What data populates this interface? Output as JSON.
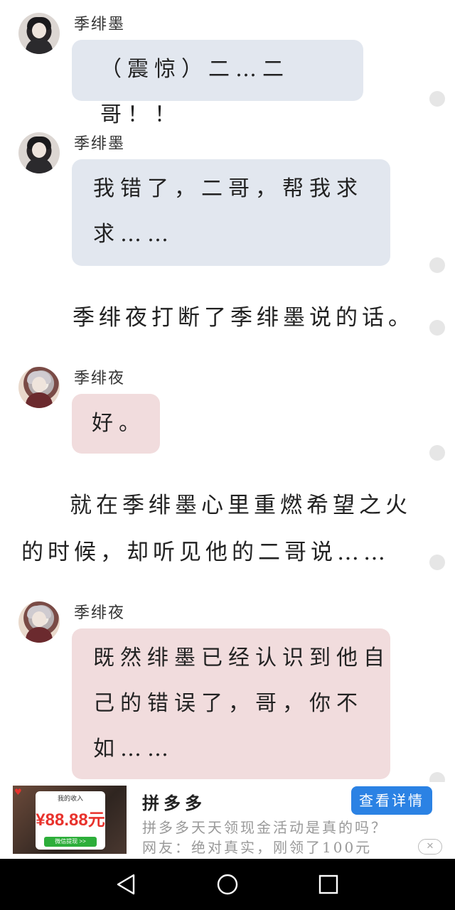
{
  "messages": [
    {
      "speaker": "季绯墨",
      "text": "（震惊）二…二哥！！",
      "avatar": "dark-haired-avatar"
    },
    {
      "speaker": "季绯墨",
      "line1": "我错了，二哥，帮我求",
      "line2": "求……",
      "avatar": "dark-haired-avatar"
    },
    {
      "speaker": "季绯夜",
      "text": "好。",
      "avatar": "silver-haired-avatar"
    },
    {
      "speaker": "季绯夜",
      "line1": "既然绯墨已经认识到他自",
      "line2": "己的错误了，哥，你不",
      "line3": "如……",
      "avatar": "silver-haired-avatar"
    }
  ],
  "narrations": [
    {
      "text": "季绯夜打断了季绯墨说的话。"
    },
    {
      "line1": "就在季绯墨心里重燃希望之火",
      "line2": "的时候，却听见他的二哥说……"
    }
  ],
  "ad": {
    "card_title": "我的收入",
    "amount": "¥88.88元",
    "card_button": "微信提现 >>",
    "title": "拼多多",
    "description_line1": "拼多多天天领现金活动是真的吗？",
    "description_line2": "网友：绝对真实，刚领了100元",
    "button": "查看详情",
    "close": "✕"
  },
  "colors": {
    "blue_bubble": "#e2e7ef",
    "pink_bubble": "#f1dcdd",
    "ad_button": "#2b82e4",
    "ad_amount": "#e8322c",
    "navbar": "#000000"
  },
  "navbar": {
    "back_icon": "triangle-back-icon",
    "home_icon": "circle-home-icon",
    "recent_icon": "square-recent-icon"
  }
}
